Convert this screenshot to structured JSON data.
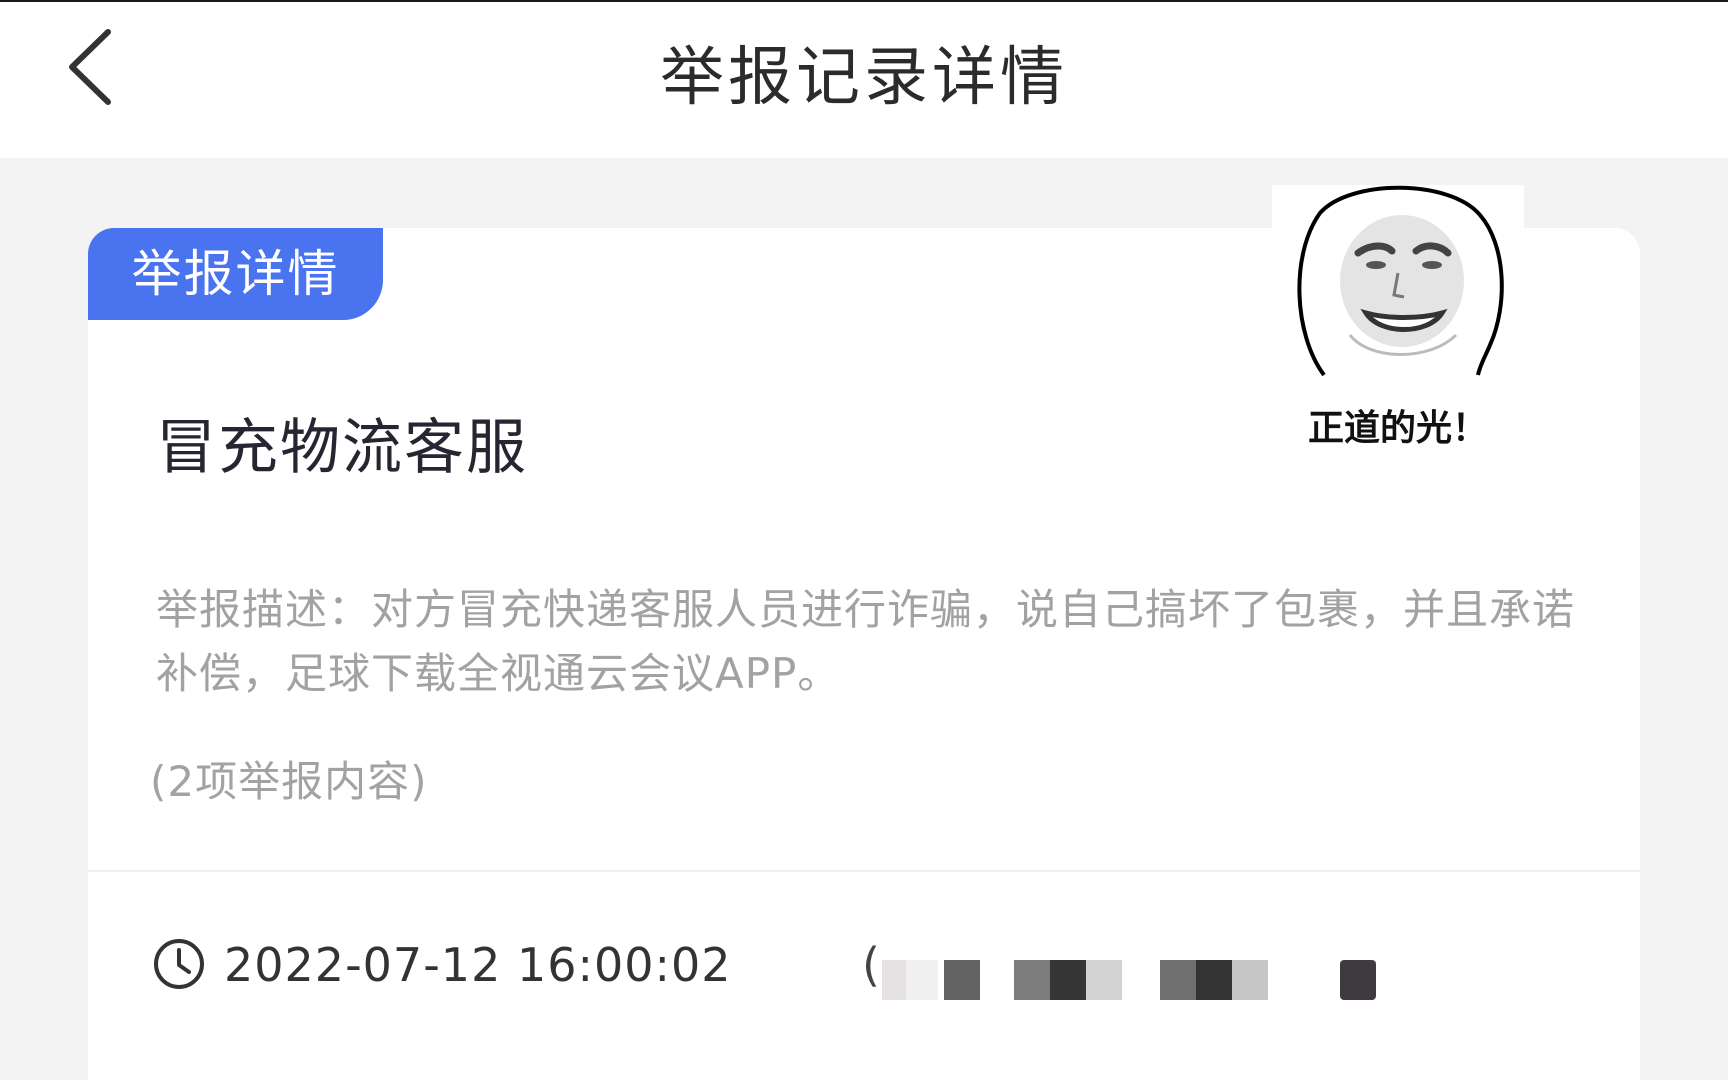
{
  "nav": {
    "title": "举报记录详情",
    "back_icon": "chevron-left-icon"
  },
  "card": {
    "tag": "举报详情",
    "title": "冒充物流客服",
    "description": "举报描述：对方冒充快递客服人员进行诈骗，说自己搞坏了包裹，并且承诺补偿，足球下载全视通云会议APP。",
    "count": "(2项举报内容)",
    "time": "2022-07-12 16:00:02",
    "time_icon": "clock-icon",
    "status_prefix": "("
  },
  "sticker": {
    "caption": "正道的光！"
  },
  "colors": {
    "accent": "#4a73f0",
    "background": "#f3f3f3",
    "card": "#ffffff",
    "muted_text": "#a2a2a2"
  }
}
